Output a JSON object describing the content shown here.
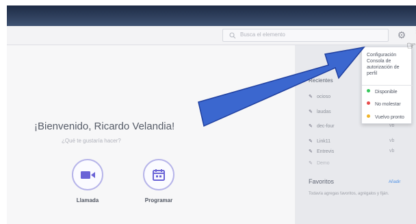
{
  "toolbar": {
    "search_placeholder": "Busca el elemento",
    "more_symbol": "⋮"
  },
  "main": {
    "welcome": "¡Bienvenido, Ricardo Velandia!",
    "subtitle": "¿Qué te gustaría hacer?",
    "actions": [
      {
        "label": "Llamada",
        "icon": "video-camera-icon"
      },
      {
        "label": "Programar",
        "icon": "calendar-icon"
      }
    ]
  },
  "sidebar": {
    "title": "Recientes",
    "meetings": [
      {
        "label": "ocioso",
        "tag": ""
      },
      {
        "label": "laudas",
        "tag": "vb"
      },
      {
        "label": "dec-four",
        "tag": "vb"
      },
      {
        "label": "Link11",
        "tag": "vb"
      },
      {
        "label": "Entrevis",
        "tag": "vb"
      },
      {
        "label": "Demo",
        "tag": ""
      }
    ],
    "favorites_title": "Favoritos",
    "favorites_link": "Añadir",
    "favorites_description": "Todavía agregas favoritos, agrégalos y fiján."
  },
  "dropdown": {
    "title": "Configuración Consola de autorización de perfil",
    "statuses": [
      {
        "label": "Disponible",
        "color": "#34c759"
      },
      {
        "label": "No molestar",
        "color": "#e84b4b"
      },
      {
        "label": "Vuelvo pronto",
        "color": "#f0b429"
      }
    ]
  },
  "arrow_color": "#3b67cf"
}
